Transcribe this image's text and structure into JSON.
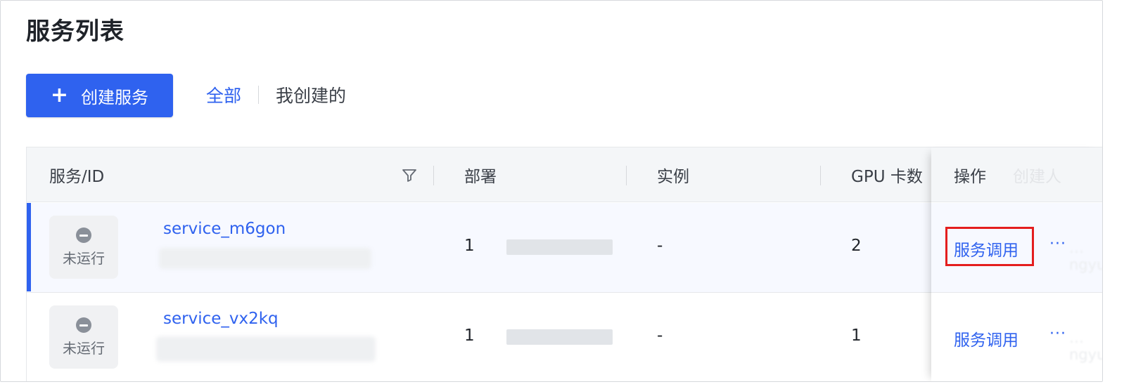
{
  "page": {
    "title": "服务列表"
  },
  "toolbar": {
    "create_label": "创建服务",
    "create_icon": "plus-icon"
  },
  "filter_tabs": [
    {
      "label": "全部",
      "active": true
    },
    {
      "label": "我创建的",
      "active": false
    }
  ],
  "table": {
    "columns": {
      "service": "服务/ID",
      "deploy": "部署",
      "instance": "实例",
      "gpu": "GPU 卡数",
      "actions": "操作",
      "creator": "创建人"
    },
    "rows": [
      {
        "status": "未运行",
        "name": "service_m6gon",
        "deploy_count": "1",
        "instance": "-",
        "gpu": "2",
        "action": "服务调用",
        "more": "···",
        "creator": "…ngyuan",
        "selected": true
      },
      {
        "status": "未运行",
        "name": "service_vx2kq",
        "deploy_count": "1",
        "instance": "-",
        "gpu": "1",
        "action": "服务调用",
        "more": "···",
        "creator": "…ngyuan",
        "selected": false
      }
    ]
  },
  "colors": {
    "accent": "#2f62ef",
    "highlight": "#e41e1e",
    "status_icon": "#8a9099"
  }
}
